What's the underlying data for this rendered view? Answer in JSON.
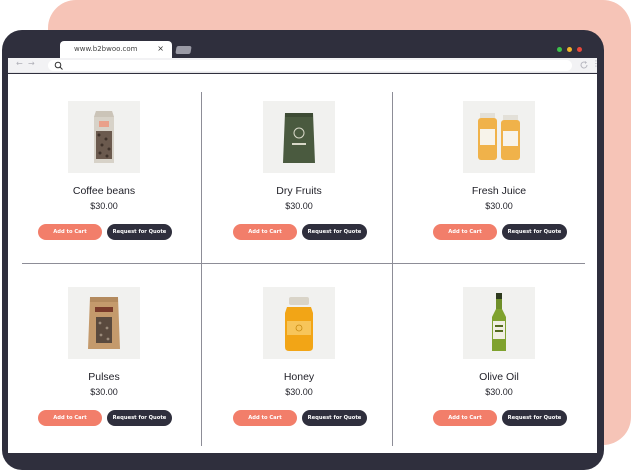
{
  "browser": {
    "tab_title": "www.b2bwoo.com",
    "tab_close": "×",
    "back": "←",
    "forward": "→",
    "menu": "⋮"
  },
  "colors": {
    "accent": "#f27e6a",
    "dark": "#2f2f3d",
    "background_shape": "#f6c4b7",
    "traffic_green": "#3cc24b",
    "traffic_yellow": "#f0b429",
    "traffic_red": "#e8483b"
  },
  "products": [
    {
      "name": "Coffee beans",
      "price": "$30.00",
      "cart_label": "Add to Cart",
      "quote_label": "Request for Quote",
      "icon": "coffee-bag-icon"
    },
    {
      "name": "Dry Fruits",
      "price": "$30.00",
      "cart_label": "Add to Cart",
      "quote_label": "Request for Quote",
      "icon": "pouch-icon"
    },
    {
      "name": "Fresh Juice",
      "price": "$30.00",
      "cart_label": "Add to Cart",
      "quote_label": "Request for Quote",
      "icon": "juice-bottles-icon"
    },
    {
      "name": "Pulses",
      "price": "$30.00",
      "cart_label": "Add to Cart",
      "quote_label": "Request for Quote",
      "icon": "sack-icon"
    },
    {
      "name": "Honey",
      "price": "$30.00",
      "cart_label": "Add to Cart",
      "quote_label": "Request for Quote",
      "icon": "honey-jar-icon"
    },
    {
      "name": "Olive Oil",
      "price": "$30.00",
      "cart_label": "Add to Cart",
      "quote_label": "Request for Quote",
      "icon": "oil-bottle-icon"
    }
  ]
}
